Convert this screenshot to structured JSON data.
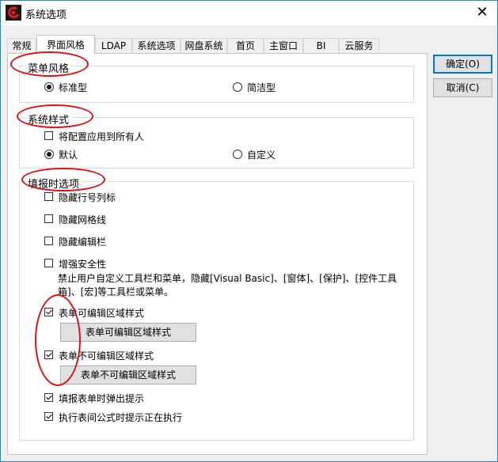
{
  "window": {
    "title": "系统选项",
    "close_glyph": "✕"
  },
  "tabs": [
    {
      "label": "常规"
    },
    {
      "label": "界面风格",
      "active": true
    },
    {
      "label": "LDAP"
    },
    {
      "label": "系统选项"
    },
    {
      "label": "网盘系统"
    },
    {
      "label": "首页"
    },
    {
      "label": "主窗口"
    },
    {
      "label": "BI"
    },
    {
      "label": "云服务"
    }
  ],
  "buttons": {
    "ok": "确定(O)",
    "cancel": "取消(C)"
  },
  "menu_style": {
    "title": "菜单风格",
    "options": [
      {
        "label": "标准型",
        "selected": true
      },
      {
        "label": "简洁型",
        "selected": false
      }
    ]
  },
  "system_style": {
    "title": "系统样式",
    "apply_all": {
      "label": "将配置应用到所有人",
      "checked": false
    },
    "options": [
      {
        "label": "默认",
        "selected": true
      },
      {
        "label": "自定义",
        "selected": false
      }
    ]
  },
  "fill_options": {
    "title": "填报时选项",
    "hide_row_col": {
      "label": "隐藏行号列标",
      "checked": false
    },
    "hide_grid": {
      "label": "隐藏网格线",
      "checked": false
    },
    "hide_edit_bar": {
      "label": "隐藏编辑栏",
      "checked": false
    },
    "security": {
      "label": "增强安全性",
      "checked": false,
      "desc": "禁止用户自定义工具栏和菜单，隐藏[Visual Basic]、[窗体]、[保护]、[控件工具箱]、[宏]等工具栏或菜单。"
    },
    "editable_style": {
      "label": "表单可编辑区域样式",
      "checked": true,
      "button": "表单可编辑区域样式"
    },
    "noneditable_style": {
      "label": "表单不可编辑区域样式",
      "checked": true,
      "button": "表单不可编辑区域样式"
    },
    "popup_tip": {
      "label": "填报表单时弹出提示",
      "checked": true
    },
    "formula_tip": {
      "label": "执行表间公式时提示正在执行",
      "checked": true
    }
  },
  "colors": {
    "annotation": "#d9141b",
    "accent": "#0078d7"
  }
}
